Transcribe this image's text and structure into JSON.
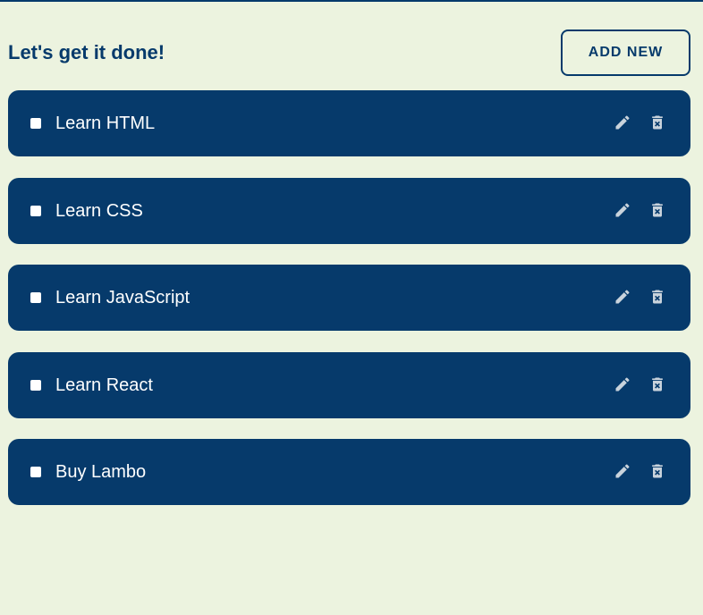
{
  "header": {
    "title": "Let's get it done!",
    "add_button_label": "ADD NEW"
  },
  "tasks": [
    {
      "label": "Learn HTML",
      "checked": false
    },
    {
      "label": "Learn CSS",
      "checked": false
    },
    {
      "label": "Learn JavaScript",
      "checked": false
    },
    {
      "label": "Learn React",
      "checked": false
    },
    {
      "label": "Buy Lambo",
      "checked": false
    }
  ],
  "icons": {
    "edit": "pencil-icon",
    "delete": "trash-icon"
  },
  "colors": {
    "background": "#ecf3df",
    "primary": "#063a6b",
    "icon": "#c9d3dc",
    "text_on_primary": "#ffffff"
  }
}
